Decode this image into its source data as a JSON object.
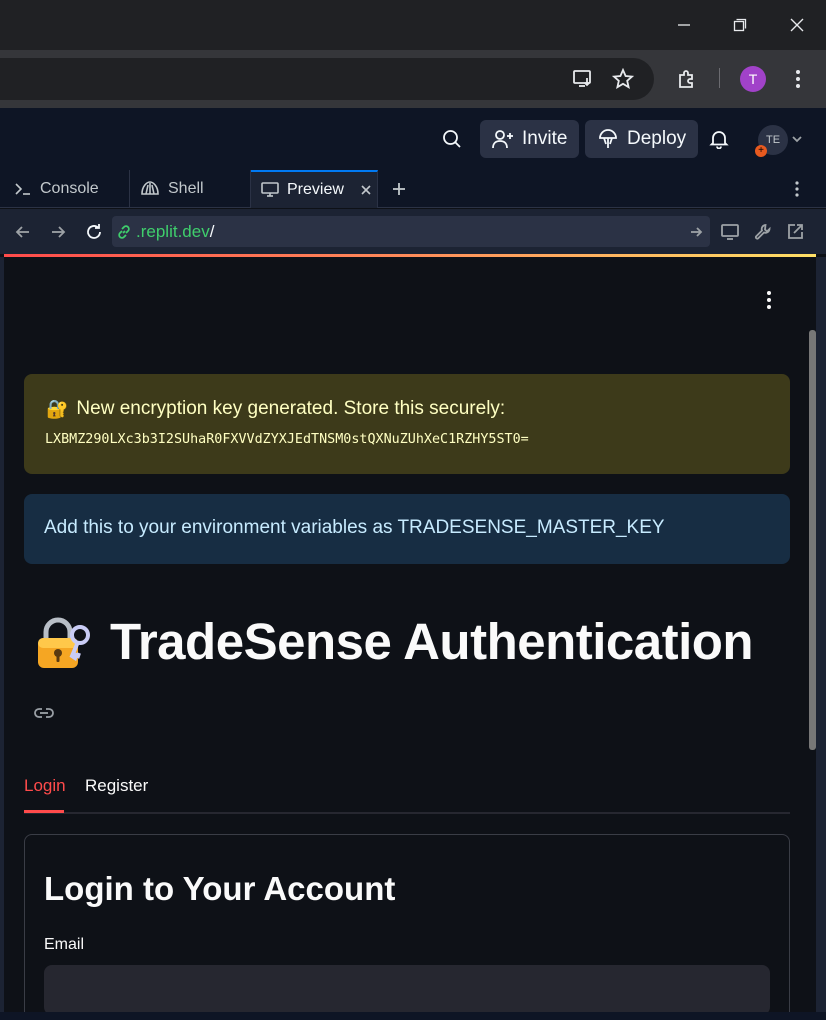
{
  "browser": {
    "profile_initial": "T"
  },
  "replit": {
    "invite_label": "Invite",
    "deploy_label": "Deploy",
    "user_initials": "TE",
    "user_badge": "+"
  },
  "tabs": [
    {
      "label": "Console"
    },
    {
      "label": "Shell"
    },
    {
      "label": "Preview"
    }
  ],
  "preview": {
    "url_host": ".replit.dev",
    "url_path": "/"
  },
  "app": {
    "warning_emoji": "🔐",
    "warning_title": "New encryption key generated. Store this securely:",
    "warning_key": "LXBMZ290LXc3b3I2SUhaR0FXVVdZYXJEdTNSM0stQXNuZUhXeC1RZHY5ST0=",
    "info_text": "Add this to your environment variables as TRADESENSE_MASTER_KEY",
    "title": "TradeSense Authentication",
    "auth_tabs": [
      {
        "label": "Login",
        "active": true
      },
      {
        "label": "Register",
        "active": false
      }
    ],
    "form_title": "Login to Your Account",
    "email_label": "Email",
    "email_value": ""
  },
  "colors": {
    "accent": "#ff4b4b",
    "warning_bg": "#3d3a1a",
    "info_bg": "#172d43",
    "replit_bg": "#0e1525"
  }
}
